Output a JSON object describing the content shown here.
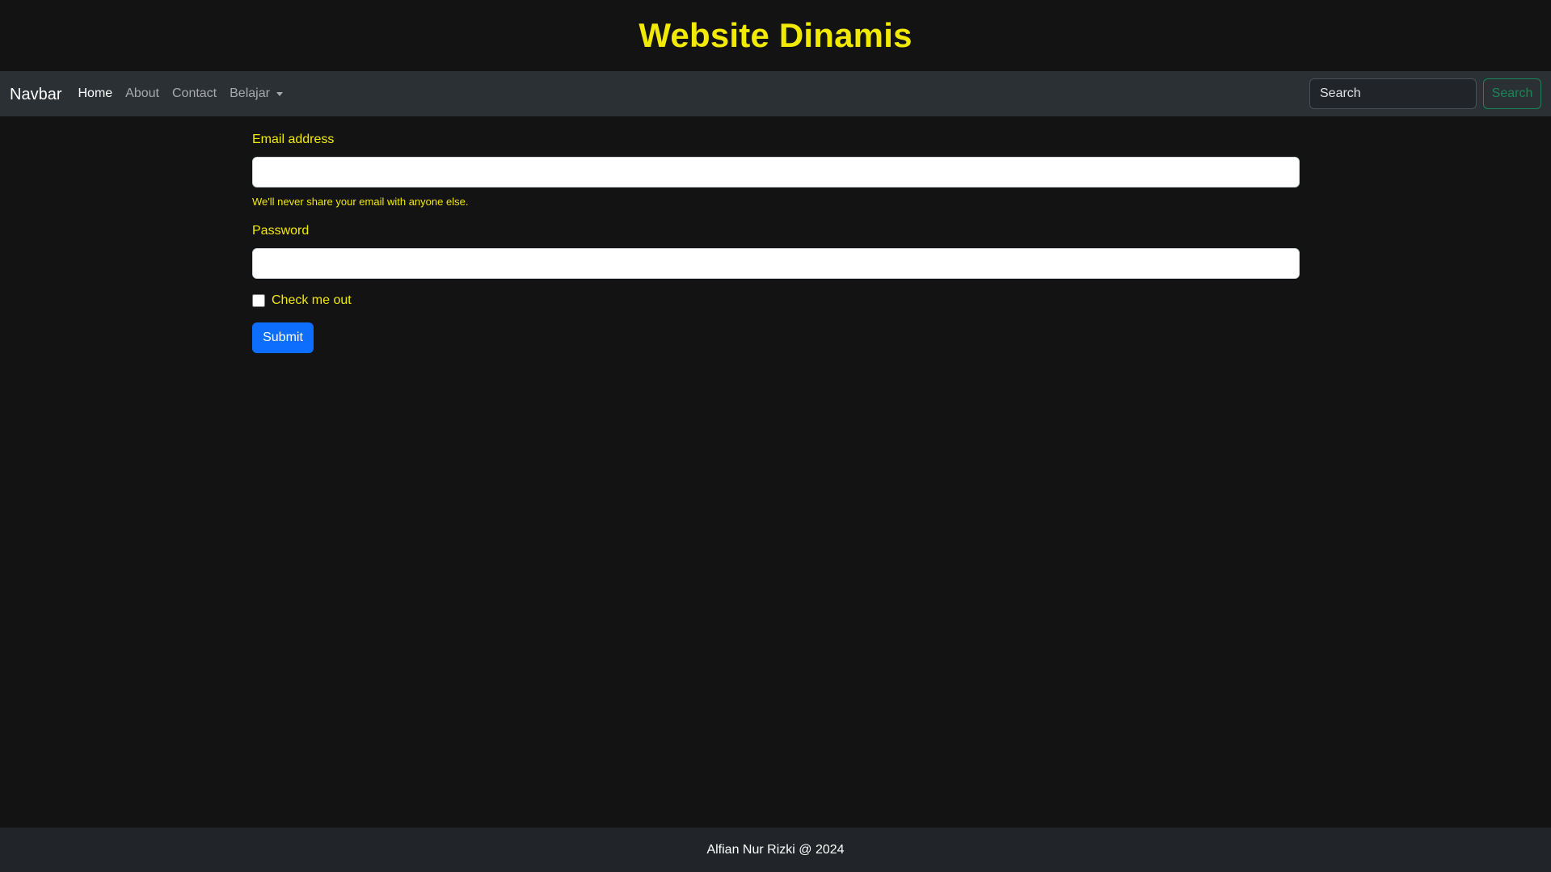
{
  "header": {
    "title": "Website Dinamis"
  },
  "navbar": {
    "brand": "Navbar",
    "items": [
      {
        "label": "Home"
      },
      {
        "label": "About"
      },
      {
        "label": "Contact"
      },
      {
        "label": "Belajar"
      }
    ],
    "active_item": "Home",
    "search": {
      "placeholder": "Search",
      "button_label": "Search"
    }
  },
  "form": {
    "email": {
      "label": "Email address",
      "value": "",
      "help": "We'll never share your email with anyone else."
    },
    "password": {
      "label": "Password",
      "value": ""
    },
    "checkbox": {
      "label": "Check me out",
      "checked": false
    },
    "submit_label": "Submit"
  },
  "footer": {
    "text": "Alfian Nur Rizki @ 2024"
  },
  "colors": {
    "page_background": "#131313",
    "navbar_background": "#2b3035",
    "footer_background": "#212529",
    "accent_yellow": "#f2ea00",
    "primary_button": "#0d6efd",
    "search_button_outline": "#198754"
  },
  "icons": {
    "dropdown": "caret-down-icon"
  }
}
